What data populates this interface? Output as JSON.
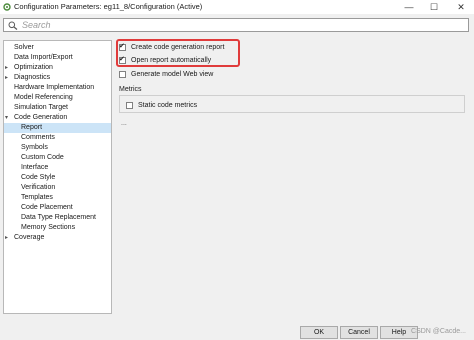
{
  "window": {
    "title": "Configuration Parameters: eg11_8/Configuration (Active)",
    "minimize_label": "—",
    "maximize_label": "☐",
    "close_label": "✕"
  },
  "search": {
    "placeholder": "Search"
  },
  "tree": {
    "items": [
      {
        "label": "Solver"
      },
      {
        "label": "Data Import/Export"
      },
      {
        "label": "Optimization",
        "arrow": "▸"
      },
      {
        "label": "Diagnostics",
        "arrow": "▸"
      },
      {
        "label": "Hardware Implementation"
      },
      {
        "label": "Model Referencing"
      },
      {
        "label": "Simulation Target"
      },
      {
        "label": "Code Generation",
        "arrow": "▾"
      },
      {
        "label": "Report"
      },
      {
        "label": "Comments"
      },
      {
        "label": "Symbols"
      },
      {
        "label": "Custom Code"
      },
      {
        "label": "Interface"
      },
      {
        "label": "Code Style"
      },
      {
        "label": "Verification"
      },
      {
        "label": "Templates"
      },
      {
        "label": "Code Placement"
      },
      {
        "label": "Data Type Replacement"
      },
      {
        "label": "Memory Sections"
      },
      {
        "label": "Coverage",
        "arrow": "▸"
      }
    ],
    "selected": "Report"
  },
  "report": {
    "create_report": {
      "label": "Create code generation report",
      "checked": true
    },
    "open_report": {
      "label": "Open report automatically",
      "checked": true
    },
    "model_web_view": {
      "label": "Generate model Web view",
      "checked": false
    },
    "metrics_label": "Metrics",
    "static_metrics": {
      "label": "Static code metrics",
      "checked": false
    },
    "ellipsis": "..."
  },
  "footer": {
    "ok_label": "OK",
    "cancel_label": "Cancel",
    "help_label": "Help",
    "watermark": "CSDN @Cacde..."
  }
}
